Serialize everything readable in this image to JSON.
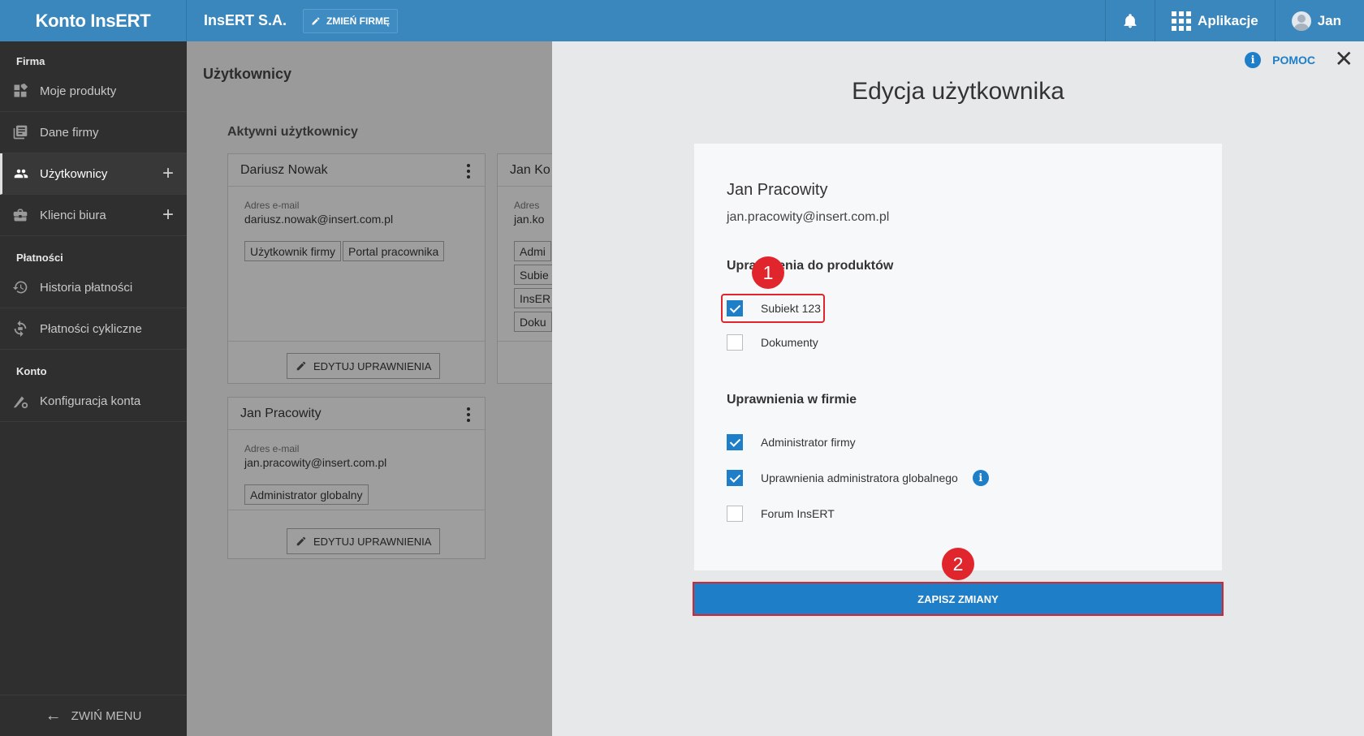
{
  "topbar": {
    "brand": "Konto InsERT",
    "company": "InsERT S.A.",
    "change_company": "ZMIEŃ FIRMĘ",
    "apps": "Aplikacje",
    "user": "Jan"
  },
  "sidebar": {
    "sections": [
      {
        "title": "Firma",
        "items": [
          {
            "label": "Moje produkty",
            "icon": "dashboard-icon"
          },
          {
            "label": "Dane firmy",
            "icon": "document-list-icon"
          },
          {
            "label": "Użytkownicy",
            "icon": "users-icon",
            "active": true,
            "plus": true
          },
          {
            "label": "Klienci biura",
            "icon": "briefcase-icon",
            "plus": true
          }
        ]
      },
      {
        "title": "Płatności",
        "items": [
          {
            "label": "Historia płatności",
            "icon": "history-icon"
          },
          {
            "label": "Płatności cykliczne",
            "icon": "recurring-payment-icon"
          }
        ]
      },
      {
        "title": "Konto",
        "items": [
          {
            "label": "Konfiguracja konta",
            "icon": "settings-config-icon"
          }
        ]
      }
    ],
    "collapse_label": "ZWIŃ MENU"
  },
  "main": {
    "title": "Użytkownicy",
    "section_title": "Aktywni użytkownicy",
    "cards": [
      {
        "name": "Dariusz Nowak",
        "email_label": "Adres e-mail",
        "email": "dariusz.nowak@insert.com.pl",
        "tags": [
          "Użytkownik firmy",
          "Portal pracownika"
        ],
        "edit": "EDYTUJ UPRAWNIENIA"
      },
      {
        "name": "Jan Ko",
        "email_label": "Adres",
        "email": "jan.ko",
        "tags": [
          "Admi",
          "Subie",
          "InsER",
          "Doku"
        ]
      },
      {
        "name": "Jan Pracowity",
        "email_label": "Adres e-mail",
        "email": "jan.pracowity@insert.com.pl",
        "tags": [
          "Administrator globalny"
        ],
        "edit": "EDYTUJ UPRAWNIENIA"
      }
    ]
  },
  "panel": {
    "help": "POMOC",
    "title": "Edycja użytkownika",
    "user_name": "Jan Pracowity",
    "user_email": "jan.pracowity@insert.com.pl",
    "products_heading": "Uprawnienia do produktów",
    "products": [
      {
        "label": "Subiekt 123",
        "checked": true
      },
      {
        "label": "Dokumenty",
        "checked": false
      }
    ],
    "company_heading": "Uprawnienia w firmie",
    "company_perms": [
      {
        "label": "Administrator firmy",
        "checked": true
      },
      {
        "label": "Uprawnienia administratora globalnego",
        "checked": true,
        "info": true
      },
      {
        "label": "Forum InsERT",
        "checked": false
      }
    ],
    "save": "ZAPISZ ZMIANY"
  },
  "annotations": {
    "step1": "1",
    "step2": "2",
    "color": "#e0262c"
  },
  "colors": {
    "brand_blue": "#3a87be",
    "accent": "#1e7ec8",
    "sidebar_bg": "#2f2f2f"
  }
}
